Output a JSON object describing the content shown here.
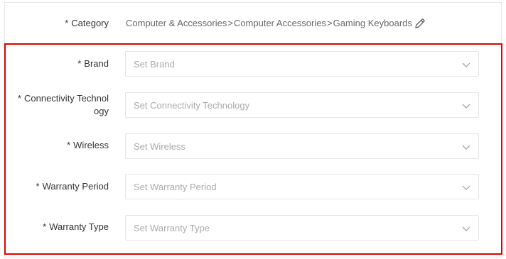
{
  "category": {
    "label": "Category",
    "path": [
      "Computer & Accessories",
      "Computer Accessories",
      "Gaming Keyboards"
    ],
    "separator": ">"
  },
  "fields": [
    {
      "label": "Brand",
      "placeholder": "Set Brand"
    },
    {
      "label": "Connectivity Technol\nogy",
      "placeholder": "Set Connectivity Technology"
    },
    {
      "label": "Wireless",
      "placeholder": "Set Wireless"
    },
    {
      "label": "Warranty Period",
      "placeholder": "Set Warranty Period"
    },
    {
      "label": "Warranty Type",
      "placeholder": "Set Warranty Type"
    }
  ],
  "required_mark": "*",
  "icons": {
    "edit": "pencil-icon",
    "dropdown": "chevron-down-icon"
  },
  "colors": {
    "highlight_border": "#e00000",
    "placeholder": "#aaaaaa",
    "border": "#e5e5e5"
  }
}
